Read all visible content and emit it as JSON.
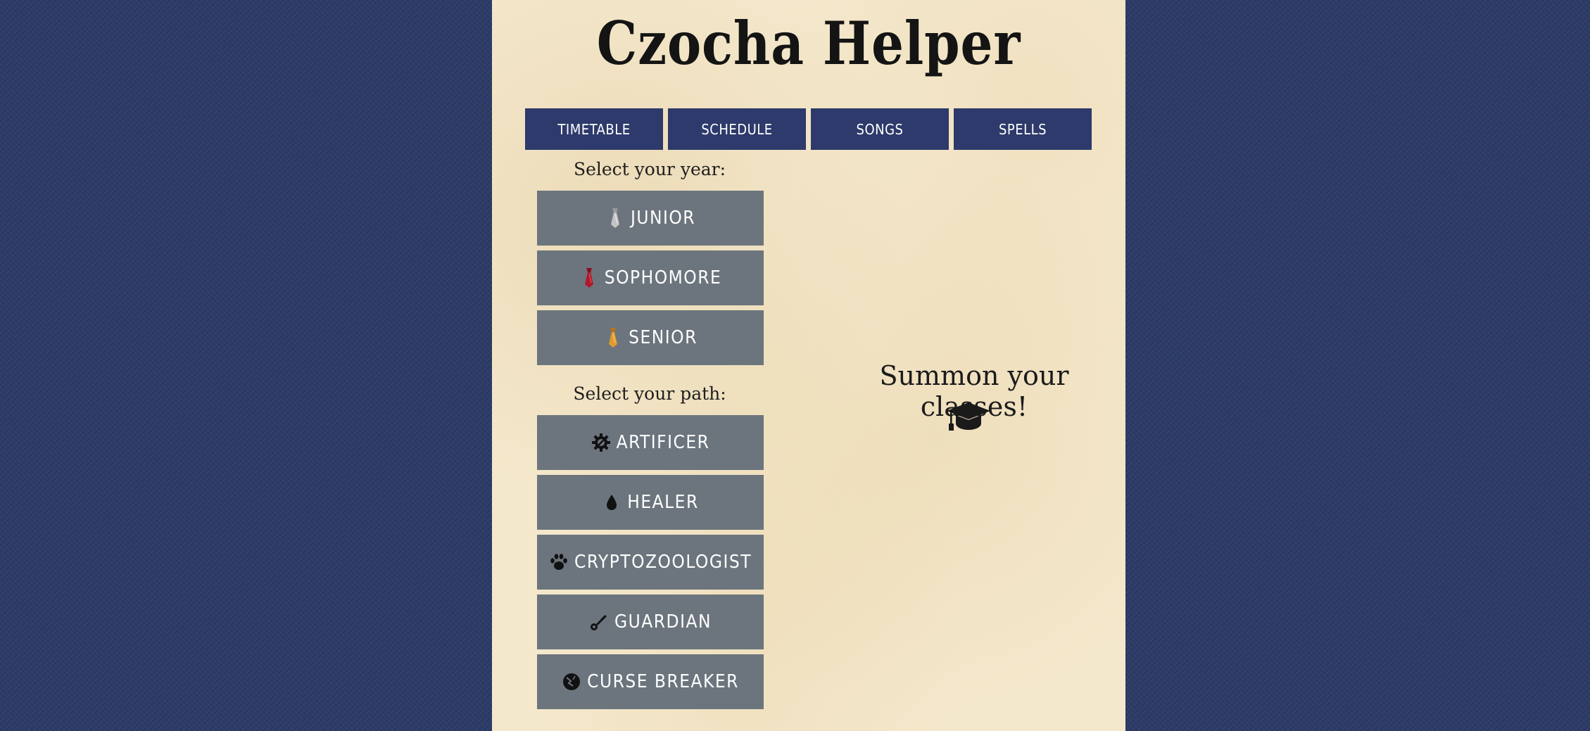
{
  "site": {
    "title": "Czocha Helper"
  },
  "nav": {
    "items": [
      {
        "label": "TIMETABLE"
      },
      {
        "label": "SCHEDULE"
      },
      {
        "label": "SONGS"
      },
      {
        "label": "SPELLS"
      }
    ]
  },
  "year": {
    "label": "Select your year:",
    "options": [
      {
        "label": "JUNIOR",
        "icon": "silver-tie-icon",
        "color": "#b8b8b8"
      },
      {
        "label": "SOPHOMORE",
        "icon": "red-tie-icon",
        "color": "#b0182a"
      },
      {
        "label": "SENIOR",
        "icon": "gold-tie-icon",
        "color": "#e09a2e"
      }
    ]
  },
  "path": {
    "label": "Select your path:",
    "options": [
      {
        "label": "ARTIFICER",
        "icon": "gear-icon"
      },
      {
        "label": "HEALER",
        "icon": "droplet-icon"
      },
      {
        "label": "CRYPTOZOOLOGIST",
        "icon": "paw-icon"
      },
      {
        "label": "GUARDIAN",
        "icon": "key-icon"
      },
      {
        "label": "CURSE BREAKER",
        "icon": "broken-orb-icon"
      }
    ]
  },
  "main": {
    "placeholder": "Summon your classes!",
    "icon": "graduation-cap-icon"
  },
  "colors": {
    "background": "#2b3a66",
    "parchment": "#f4e8cc",
    "nav_button": "#2d3a6b",
    "choice_button": "#6c757d"
  }
}
